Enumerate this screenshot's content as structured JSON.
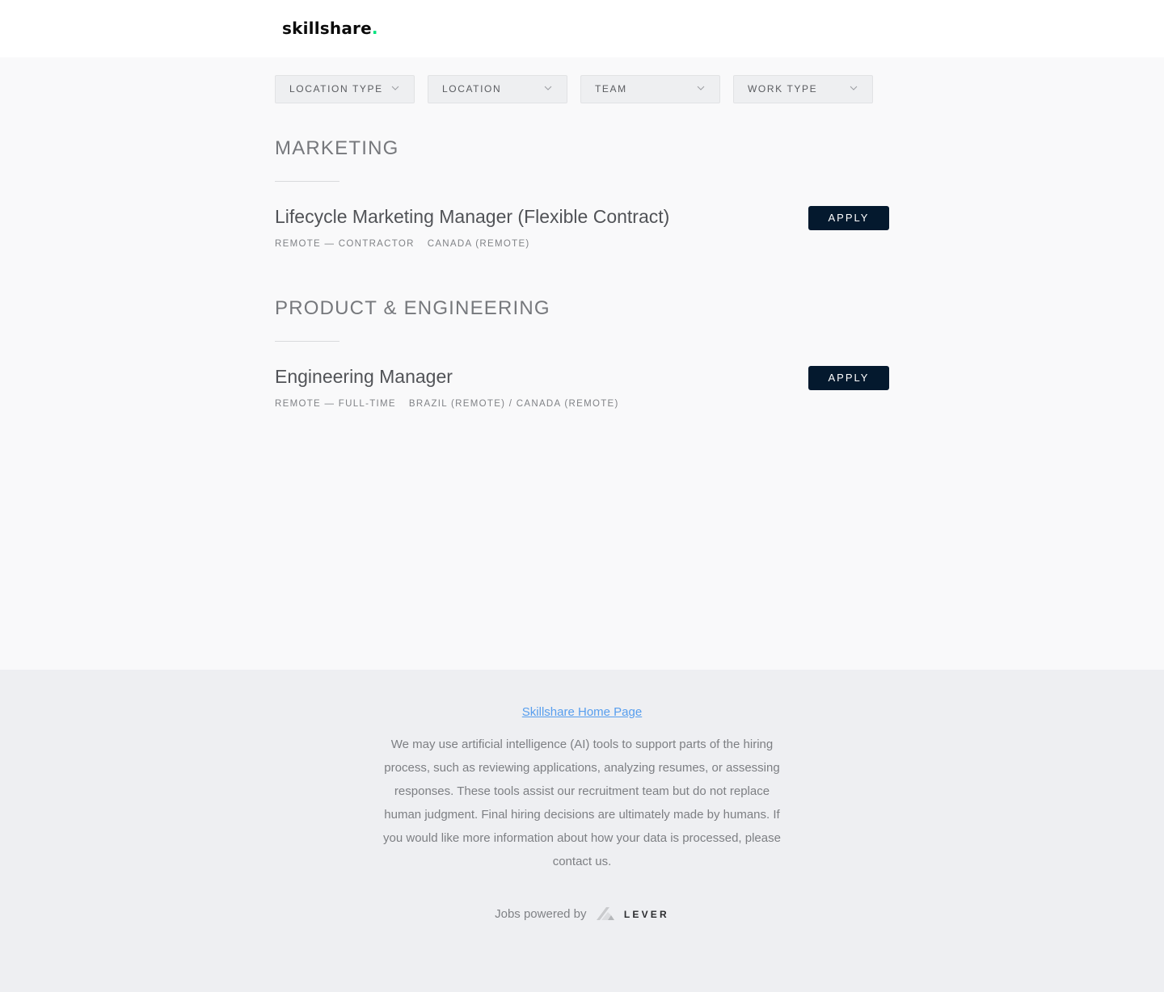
{
  "header": {
    "logo_text": "skillshare",
    "logo_dot": ".",
    "logo_dot_color": "#00e37e"
  },
  "filters": [
    {
      "label": "Location type",
      "icon": "chevron-down-icon"
    },
    {
      "label": "Location",
      "icon": "chevron-down-icon"
    },
    {
      "label": "Team",
      "icon": "chevron-down-icon"
    },
    {
      "label": "Work type",
      "icon": "chevron-down-icon"
    }
  ],
  "sections": [
    {
      "title": "Marketing",
      "postings": [
        {
          "title": "Lifecycle Marketing Manager (Flexible Contract)",
          "commitment": "Remote — Contractor",
          "location": "Canada (Remote)",
          "apply_label": "Apply"
        }
      ]
    },
    {
      "title": "Product & Engineering",
      "postings": [
        {
          "title": "Engineering Manager",
          "commitment": "Remote — Full-time",
          "location": "Brazil (Remote) / Canada (Remote)",
          "apply_label": "Apply"
        }
      ]
    }
  ],
  "footer": {
    "home_link": "Skillshare Home Page",
    "notice": "We may use artificial intelligence (AI) tools to support parts of the hiring process, such as reviewing applications, analyzing resumes, or assessing responses. These tools assist our recruitment team but do not replace human judgment. Final hiring decisions are ultimately made by humans. If you would like more information about how your data is processed, please contact us.",
    "powered_by": "Jobs powered by",
    "lever_word": "LEVER",
    "link_color": "#579eee"
  },
  "colors": {
    "apply_button": "#04192e",
    "page_background": "#f9f9fa",
    "footer_background": "#eeeff2"
  }
}
